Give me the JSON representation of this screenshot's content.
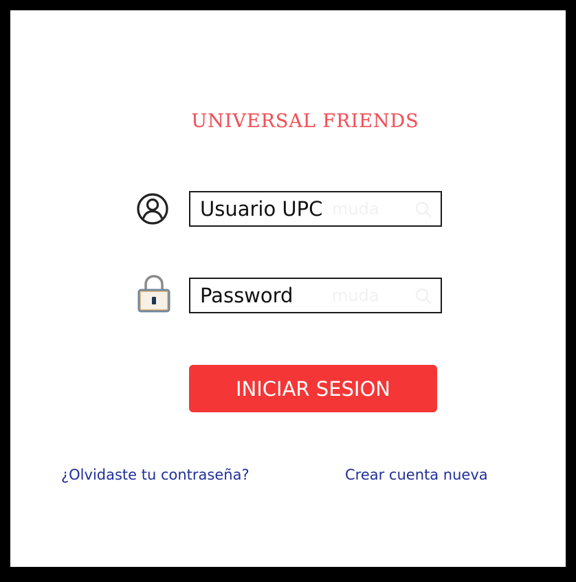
{
  "app": {
    "title": "UNIVERSAL FRIENDS"
  },
  "form": {
    "username": {
      "placeholder": "Usuario UPC",
      "value": "",
      "icon": "user-circle-icon"
    },
    "password": {
      "placeholder": "Password",
      "value": "",
      "icon": "padlock-icon"
    },
    "submit_label": "INICIAR SESION"
  },
  "links": {
    "forgot_password": "¿Olvidaste tu contraseña?",
    "create_account": "Crear cuenta nueva"
  },
  "colors": {
    "brand": "#f0525a",
    "button": "#f53636",
    "button_text": "#ffffff",
    "link": "#1f2f9a",
    "frame": "#000000"
  }
}
